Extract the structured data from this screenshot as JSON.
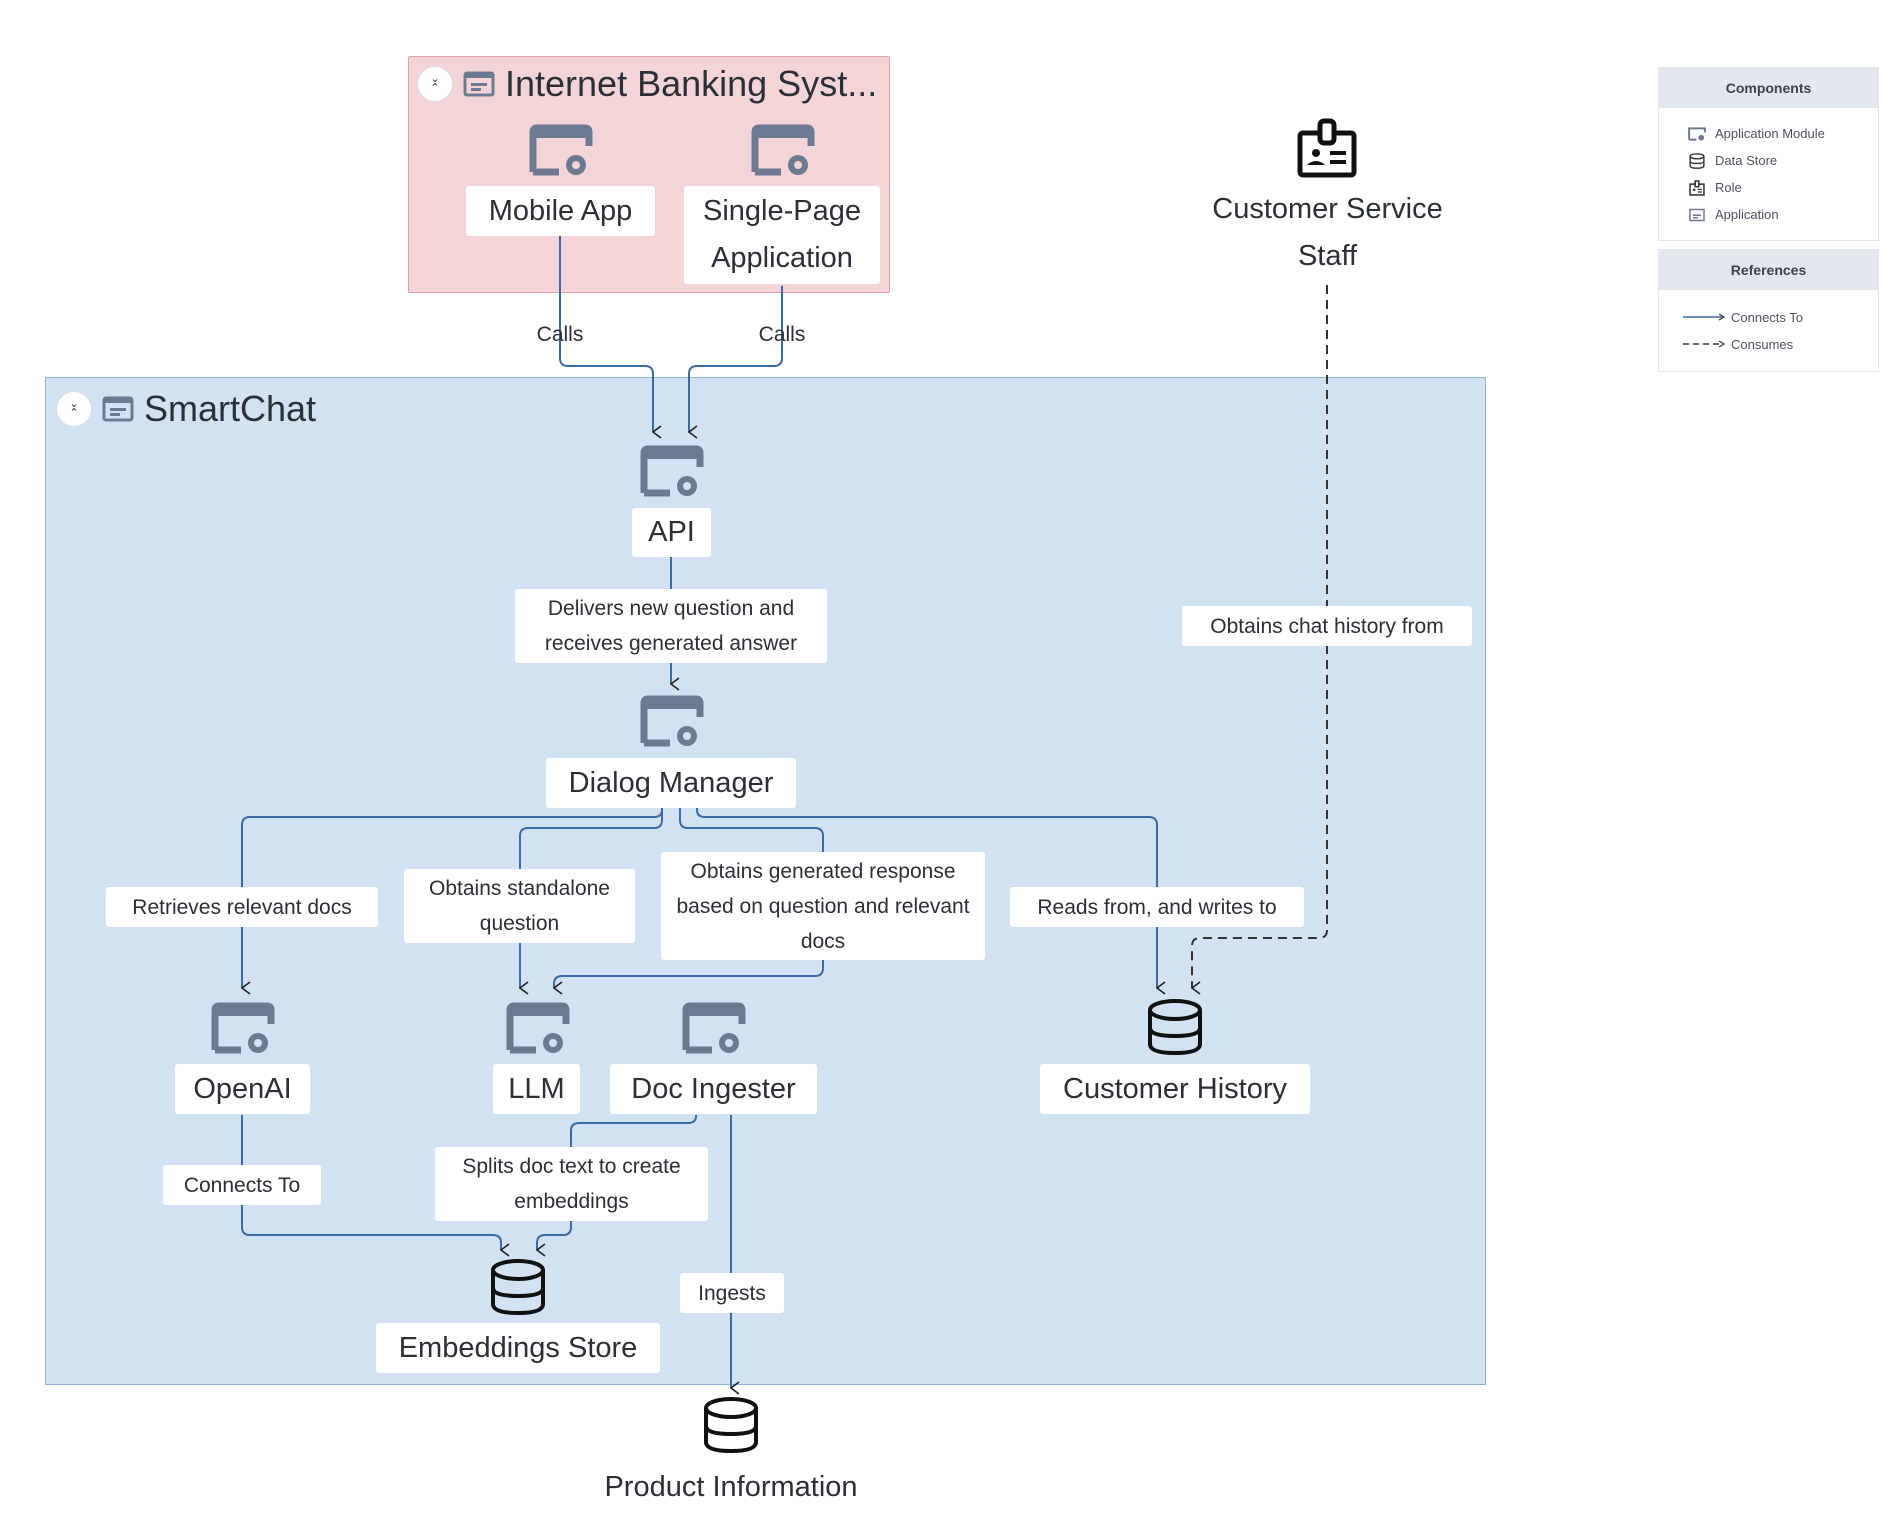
{
  "groups": {
    "internet_banking": {
      "title": "Internet Banking Syst...",
      "fill": "#f4d5d7",
      "border": "#e79ea3"
    },
    "smartchat": {
      "title": "SmartChat",
      "fill": "#d3e2f3",
      "border": "#8fb2dd"
    }
  },
  "nodes": {
    "mobile_app": {
      "label": "Mobile App",
      "type": "application-module"
    },
    "spa": {
      "label": "Single-Page Application",
      "type": "application-module"
    },
    "customer_service_staff": {
      "label": "Customer Service Staff",
      "type": "role"
    },
    "api": {
      "label": "API",
      "type": "application-module"
    },
    "dialog_manager": {
      "label": "Dialog Manager",
      "type": "application-module"
    },
    "openai": {
      "label": "OpenAI",
      "type": "application-module"
    },
    "llm": {
      "label": "LLM",
      "type": "application-module"
    },
    "doc_ingester": {
      "label": "Doc Ingester",
      "type": "application-module"
    },
    "customer_history": {
      "label": "Customer History",
      "type": "data-store"
    },
    "embeddings_store": {
      "label": "Embeddings Store",
      "type": "data-store"
    },
    "product_information": {
      "label": "Product Information",
      "type": "data-store"
    }
  },
  "edges": {
    "mobile_calls": {
      "label": "Calls",
      "from": "Mobile App",
      "to": "API",
      "kind": "connects-to"
    },
    "spa_calls": {
      "label": "Calls",
      "from": "Single-Page Application",
      "to": "API",
      "kind": "connects-to"
    },
    "api_dialog": {
      "label": "Delivers new question and receives generated answer",
      "from": "API",
      "to": "Dialog Manager",
      "kind": "connects-to"
    },
    "retrieves": {
      "label": "Retrieves relevant docs",
      "from": "Dialog Manager",
      "to": "OpenAI",
      "kind": "connects-to"
    },
    "standalone": {
      "label": "Obtains standalone question",
      "from": "Dialog Manager",
      "to": "LLM",
      "kind": "connects-to"
    },
    "generated": {
      "label": "Obtains generated response based on question and relevant docs",
      "from": "Dialog Manager",
      "to": "LLM",
      "kind": "connects-to"
    },
    "reads_writes": {
      "label": "Reads from, and writes to",
      "from": "Dialog Manager",
      "to": "Customer History",
      "kind": "connects-to"
    },
    "chat_history": {
      "label": "Obtains chat history from",
      "from": "Customer Service Staff",
      "to": "Customer History",
      "kind": "consumes"
    },
    "openai_connects": {
      "label": "Connects To",
      "from": "OpenAI",
      "to": "Embeddings Store",
      "kind": "connects-to"
    },
    "splits": {
      "label": "Splits doc text to create embeddings",
      "from": "Doc Ingester",
      "to": "Embeddings Store",
      "kind": "connects-to"
    },
    "ingests": {
      "label": "Ingests",
      "from": "Doc Ingester",
      "to": "Product Information",
      "kind": "connects-to"
    }
  },
  "legend": {
    "components_title": "Components",
    "components": [
      {
        "icon": "application-module-icon",
        "label": "Application Module"
      },
      {
        "icon": "data-store-icon",
        "label": "Data Store"
      },
      {
        "icon": "role-icon",
        "label": "Role"
      },
      {
        "icon": "application-icon",
        "label": "Application"
      }
    ],
    "references_title": "References",
    "references": [
      {
        "style": "solid",
        "label": "Connects To"
      },
      {
        "style": "dashed",
        "label": "Consumes"
      }
    ]
  },
  "colors": {
    "wire": "#3b6aa8",
    "consumes": "#333333",
    "icon_grey": "#6b7a90"
  }
}
